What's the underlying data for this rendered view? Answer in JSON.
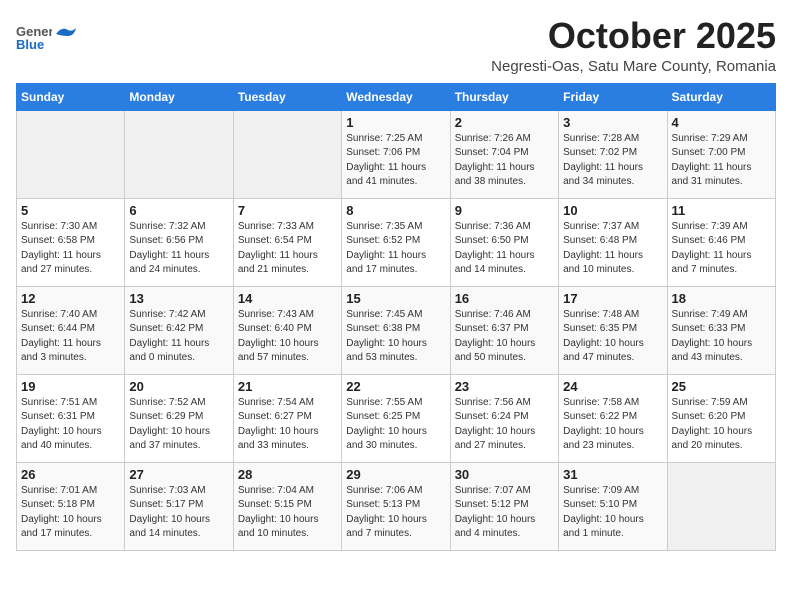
{
  "logo": {
    "general": "General",
    "blue": "Blue"
  },
  "header": {
    "month": "October 2025",
    "location": "Negresti-Oas, Satu Mare County, Romania"
  },
  "weekdays": [
    "Sunday",
    "Monday",
    "Tuesday",
    "Wednesday",
    "Thursday",
    "Friday",
    "Saturday"
  ],
  "weeks": [
    [
      {
        "day": "",
        "info": ""
      },
      {
        "day": "",
        "info": ""
      },
      {
        "day": "",
        "info": ""
      },
      {
        "day": "1",
        "info": "Sunrise: 7:25 AM\nSunset: 7:06 PM\nDaylight: 11 hours\nand 41 minutes."
      },
      {
        "day": "2",
        "info": "Sunrise: 7:26 AM\nSunset: 7:04 PM\nDaylight: 11 hours\nand 38 minutes."
      },
      {
        "day": "3",
        "info": "Sunrise: 7:28 AM\nSunset: 7:02 PM\nDaylight: 11 hours\nand 34 minutes."
      },
      {
        "day": "4",
        "info": "Sunrise: 7:29 AM\nSunset: 7:00 PM\nDaylight: 11 hours\nand 31 minutes."
      }
    ],
    [
      {
        "day": "5",
        "info": "Sunrise: 7:30 AM\nSunset: 6:58 PM\nDaylight: 11 hours\nand 27 minutes."
      },
      {
        "day": "6",
        "info": "Sunrise: 7:32 AM\nSunset: 6:56 PM\nDaylight: 11 hours\nand 24 minutes."
      },
      {
        "day": "7",
        "info": "Sunrise: 7:33 AM\nSunset: 6:54 PM\nDaylight: 11 hours\nand 21 minutes."
      },
      {
        "day": "8",
        "info": "Sunrise: 7:35 AM\nSunset: 6:52 PM\nDaylight: 11 hours\nand 17 minutes."
      },
      {
        "day": "9",
        "info": "Sunrise: 7:36 AM\nSunset: 6:50 PM\nDaylight: 11 hours\nand 14 minutes."
      },
      {
        "day": "10",
        "info": "Sunrise: 7:37 AM\nSunset: 6:48 PM\nDaylight: 11 hours\nand 10 minutes."
      },
      {
        "day": "11",
        "info": "Sunrise: 7:39 AM\nSunset: 6:46 PM\nDaylight: 11 hours\nand 7 minutes."
      }
    ],
    [
      {
        "day": "12",
        "info": "Sunrise: 7:40 AM\nSunset: 6:44 PM\nDaylight: 11 hours\nand 3 minutes."
      },
      {
        "day": "13",
        "info": "Sunrise: 7:42 AM\nSunset: 6:42 PM\nDaylight: 11 hours\nand 0 minutes."
      },
      {
        "day": "14",
        "info": "Sunrise: 7:43 AM\nSunset: 6:40 PM\nDaylight: 10 hours\nand 57 minutes."
      },
      {
        "day": "15",
        "info": "Sunrise: 7:45 AM\nSunset: 6:38 PM\nDaylight: 10 hours\nand 53 minutes."
      },
      {
        "day": "16",
        "info": "Sunrise: 7:46 AM\nSunset: 6:37 PM\nDaylight: 10 hours\nand 50 minutes."
      },
      {
        "day": "17",
        "info": "Sunrise: 7:48 AM\nSunset: 6:35 PM\nDaylight: 10 hours\nand 47 minutes."
      },
      {
        "day": "18",
        "info": "Sunrise: 7:49 AM\nSunset: 6:33 PM\nDaylight: 10 hours\nand 43 minutes."
      }
    ],
    [
      {
        "day": "19",
        "info": "Sunrise: 7:51 AM\nSunset: 6:31 PM\nDaylight: 10 hours\nand 40 minutes."
      },
      {
        "day": "20",
        "info": "Sunrise: 7:52 AM\nSunset: 6:29 PM\nDaylight: 10 hours\nand 37 minutes."
      },
      {
        "day": "21",
        "info": "Sunrise: 7:54 AM\nSunset: 6:27 PM\nDaylight: 10 hours\nand 33 minutes."
      },
      {
        "day": "22",
        "info": "Sunrise: 7:55 AM\nSunset: 6:25 PM\nDaylight: 10 hours\nand 30 minutes."
      },
      {
        "day": "23",
        "info": "Sunrise: 7:56 AM\nSunset: 6:24 PM\nDaylight: 10 hours\nand 27 minutes."
      },
      {
        "day": "24",
        "info": "Sunrise: 7:58 AM\nSunset: 6:22 PM\nDaylight: 10 hours\nand 23 minutes."
      },
      {
        "day": "25",
        "info": "Sunrise: 7:59 AM\nSunset: 6:20 PM\nDaylight: 10 hours\nand 20 minutes."
      }
    ],
    [
      {
        "day": "26",
        "info": "Sunrise: 7:01 AM\nSunset: 5:18 PM\nDaylight: 10 hours\nand 17 minutes."
      },
      {
        "day": "27",
        "info": "Sunrise: 7:03 AM\nSunset: 5:17 PM\nDaylight: 10 hours\nand 14 minutes."
      },
      {
        "day": "28",
        "info": "Sunrise: 7:04 AM\nSunset: 5:15 PM\nDaylight: 10 hours\nand 10 minutes."
      },
      {
        "day": "29",
        "info": "Sunrise: 7:06 AM\nSunset: 5:13 PM\nDaylight: 10 hours\nand 7 minutes."
      },
      {
        "day": "30",
        "info": "Sunrise: 7:07 AM\nSunset: 5:12 PM\nDaylight: 10 hours\nand 4 minutes."
      },
      {
        "day": "31",
        "info": "Sunrise: 7:09 AM\nSunset: 5:10 PM\nDaylight: 10 hours\nand 1 minute."
      },
      {
        "day": "",
        "info": ""
      }
    ]
  ]
}
